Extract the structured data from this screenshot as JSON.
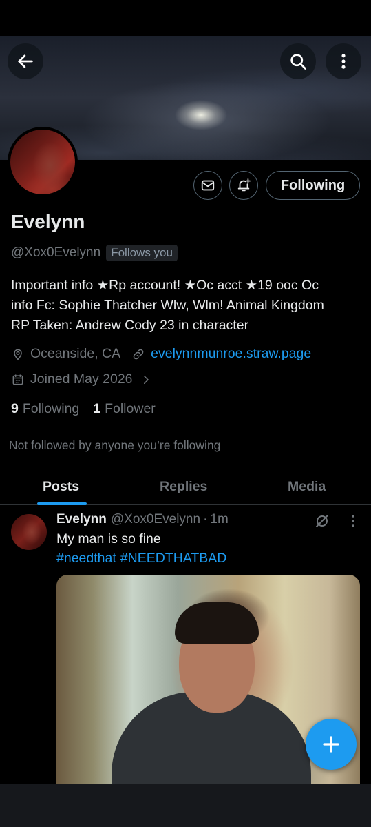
{
  "profile": {
    "display_name": "Evelynn",
    "handle": "@Xox0Evelynn",
    "follows_you": "Follows you",
    "bio_lines": [
      "Important info ★Rp account! ★Oc acct  ★19 ooc  Oc",
      "info Fc: Sophie Thatcher  Wlw, Wlm! Animal Kingdom",
      "RP Taken: Andrew Cody  23 in character"
    ],
    "location": "Oceanside, CA",
    "website": "evelynnmunroe.straw.page",
    "joined": "Joined May 2026",
    "following_count": "9",
    "following_label": "Following",
    "follower_count": "1",
    "follower_label": "Follower",
    "not_followed": "Not followed by anyone you’re following"
  },
  "actions": {
    "follow_state": "Following",
    "icons": [
      "back-arrow-icon",
      "search-icon",
      "more-vertical-icon",
      "mail-icon",
      "notification-bell-icon"
    ]
  },
  "tabs": [
    {
      "label": "Posts",
      "active": true
    },
    {
      "label": "Replies",
      "active": false
    },
    {
      "label": "Media",
      "active": false
    }
  ],
  "post": {
    "name": "Evelynn",
    "handle": "@Xox0Evelynn",
    "dot": "·",
    "time": "1m",
    "text": "My man is so fine",
    "hashtags": [
      "#needthat",
      "#NEEDTHATBAD"
    ]
  },
  "colors": {
    "accent": "#1d9bf0",
    "background": "#000000",
    "muted": "#71767b",
    "text": "#e7e9ea"
  }
}
